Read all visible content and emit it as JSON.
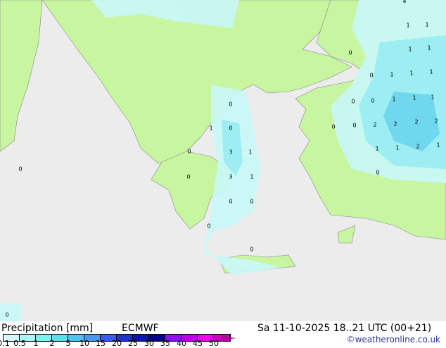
{
  "header": {
    "title": "Precipitation [mm]",
    "model": "ECMWF",
    "datetime": "Sa 11-10-2025 18..21 UTC (00+21)",
    "credit": "©weatheronline.co.uk"
  },
  "legend": {
    "ticks": [
      "0.1",
      "0.5",
      "1",
      "2",
      "5",
      "10",
      "15",
      "20",
      "25",
      "30",
      "35",
      "40",
      "45",
      "50"
    ],
    "colors": [
      "#d8fafa",
      "#a8f8f8",
      "#84eeee",
      "#64dcee",
      "#58c0ee",
      "#4c98ee",
      "#3a5cf0",
      "#2034c8",
      "#0a1aa8",
      "#00008c",
      "#9010f0",
      "#c000e8",
      "#f000f0",
      "#d000c0"
    ],
    "arrow_color": "#a01090"
  },
  "colors": {
    "sea": "#ececec",
    "land": "#c8f5a0",
    "precip_light": "#c8f8f8",
    "precip_mid": "#9ceef2",
    "precip_high": "#70d8ee"
  },
  "map_values": [
    "4",
    "1",
    "1",
    "0",
    "1",
    "1",
    "0",
    "1",
    "1",
    "1",
    "0",
    "0",
    "0",
    "1",
    "1",
    "1",
    "1",
    "0",
    "0",
    "0",
    "2",
    "2",
    "2",
    "2",
    "0",
    "3",
    "1",
    "1",
    "1",
    "2",
    "1",
    "0",
    "0",
    "3",
    "1",
    "0",
    "0",
    "0",
    "0",
    "0",
    "0"
  ]
}
